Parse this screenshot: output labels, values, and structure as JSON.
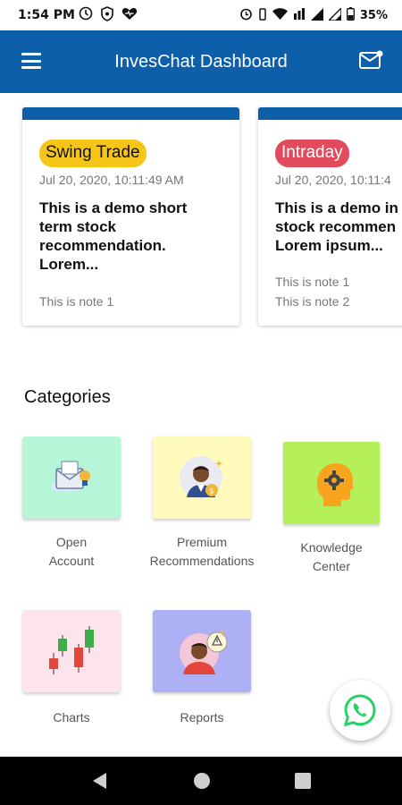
{
  "status_bar": {
    "time": "1:54 PM",
    "battery": "35%",
    "left_icons": [
      "sync-icon",
      "shield-icon",
      "heart-icon"
    ],
    "right_icons": [
      "alarm-icon",
      "vibrate-icon",
      "wifi-icon",
      "data-icon",
      "signal-icon",
      "signal-icon",
      "battery-icon"
    ]
  },
  "header": {
    "title": "InvesChat Dashboard",
    "menu_icon": "hamburger-menu-icon",
    "mail_icon": "mail-notification-icon"
  },
  "colors": {
    "primary": "#0c5fa8",
    "swing_badge": "#f5c518",
    "intraday_badge": "#e24a5e",
    "whatsapp": "#25d366"
  },
  "recommendations": [
    {
      "tag": "Swing Trade",
      "date": "Jul 20, 2020, 10:11:49 AM",
      "text_lines": [
        "This is a demo short",
        "term stock",
        "recommendation.",
        "Lorem..."
      ],
      "notes": [
        "This is note 1"
      ]
    },
    {
      "tag": "Intraday",
      "date": "Jul 20, 2020, 10:11:4",
      "text_lines": [
        "This is a demo in",
        "stock recommen",
        "Lorem ipsum..."
      ],
      "notes": [
        "This is note 1",
        "This is note 2"
      ]
    }
  ],
  "categories": {
    "title": "Categories",
    "items": [
      {
        "label_lines": [
          "Open",
          "Account"
        ],
        "icon": "open-account-icon",
        "bg": "#b7f5d8"
      },
      {
        "label_lines": [
          "Premium",
          "Recommendations"
        ],
        "icon": "premium-advisor-icon",
        "bg": "#fffbbd"
      },
      {
        "label_lines": [
          "Knowledge",
          "Center"
        ],
        "icon": "knowledge-head-gear-icon",
        "bg": "#b5f05a"
      },
      {
        "label_lines": [
          "Charts"
        ],
        "icon": "candlestick-chart-icon",
        "bg": "#fde4ec"
      },
      {
        "label_lines": [
          "Reports"
        ],
        "icon": "reports-person-icon",
        "bg": "#aeb0f5"
      }
    ]
  },
  "fab": {
    "icon": "whatsapp-icon"
  },
  "nav_bar": {
    "buttons": [
      "back-icon",
      "home-icon",
      "recents-icon"
    ]
  }
}
